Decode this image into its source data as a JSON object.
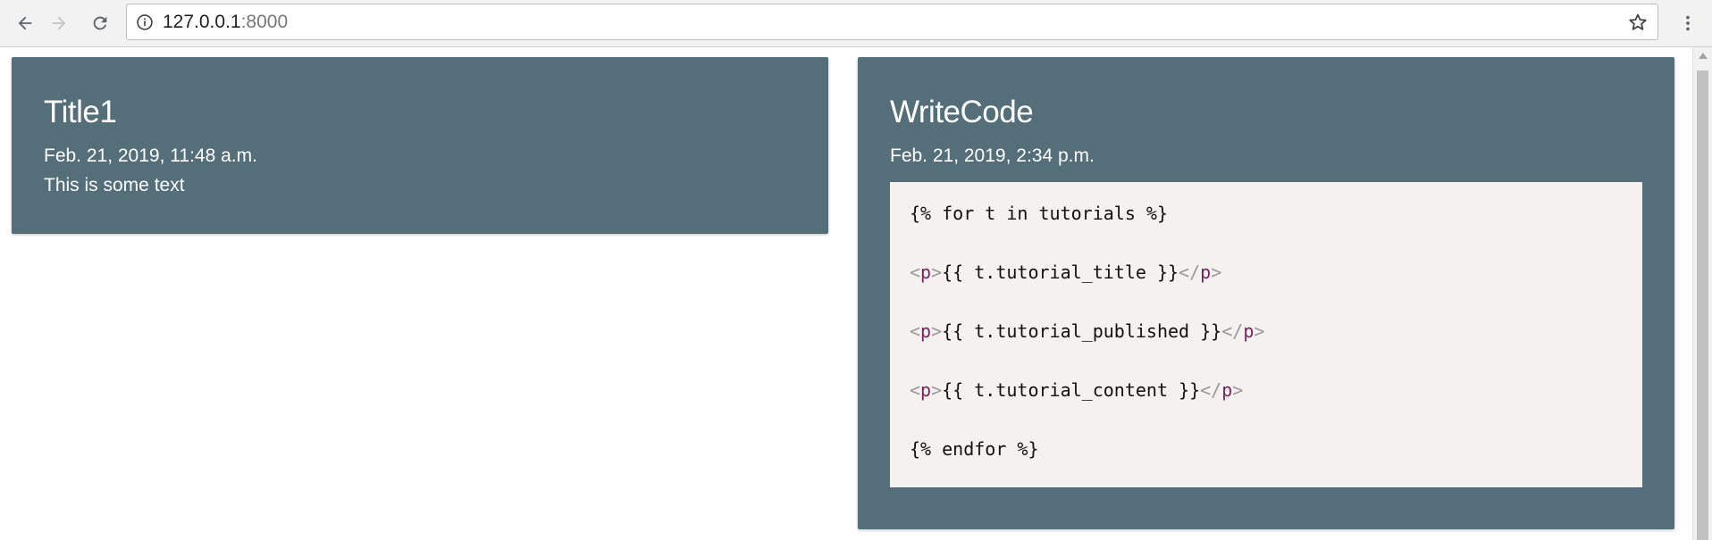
{
  "browser": {
    "url_host": "127.0.0.1",
    "url_port": ":8000"
  },
  "cards": [
    {
      "title": "Title1",
      "date": "Feb. 21, 2019, 11:48 a.m.",
      "text": "This is some text"
    },
    {
      "title": "WriteCode",
      "date": "Feb. 21, 2019, 2:34 p.m.",
      "code": {
        "line1": "{% for t in tutorials %}",
        "line2_content": "{{ t.tutorial_title }}",
        "line3_content": "{{ t.tutorial_published }}",
        "line4_content": "{{ t.tutorial_content }}",
        "line5": "{% endfor %}",
        "tag_open_lt": "<",
        "tag_name": "p",
        "tag_gt": ">",
        "tag_close_lt": "</"
      }
    }
  ],
  "colors": {
    "card_bg": "#546e7a",
    "code_bg": "#f4f1ee",
    "tag_name": "#7a1f5e",
    "tag_bracket": "#999999"
  }
}
